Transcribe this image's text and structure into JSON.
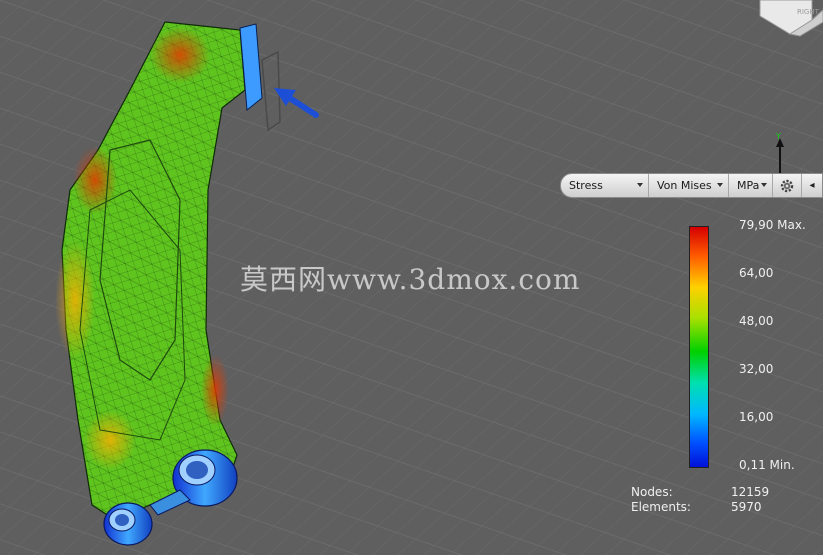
{
  "toolbar": {
    "result_type": "Stress",
    "component": "Von Mises",
    "unit": "MPa",
    "settings_icon": "gear-icon",
    "more_icon": "chevron-right-icon"
  },
  "legend": {
    "max_label": "79,90 Max.",
    "ticks": [
      "64,00",
      "48,00",
      "32,00",
      "16,00"
    ],
    "min_label": "0,11 Min.",
    "colors": [
      "#d40000",
      "#ff5a00",
      "#ffd000",
      "#a8e000",
      "#00d000",
      "#00e0b0",
      "#00b8ff",
      "#0050ff",
      "#0010d8"
    ]
  },
  "mesh_info": {
    "nodes_label": "Nodes:",
    "nodes_value": "12159",
    "elements_label": "Elements:",
    "elements_value": "5970"
  },
  "view_cube": {
    "face_label": "RIGHT"
  },
  "axis": {
    "label": "Y"
  },
  "watermark": "莫西网www.3dmox.com"
}
